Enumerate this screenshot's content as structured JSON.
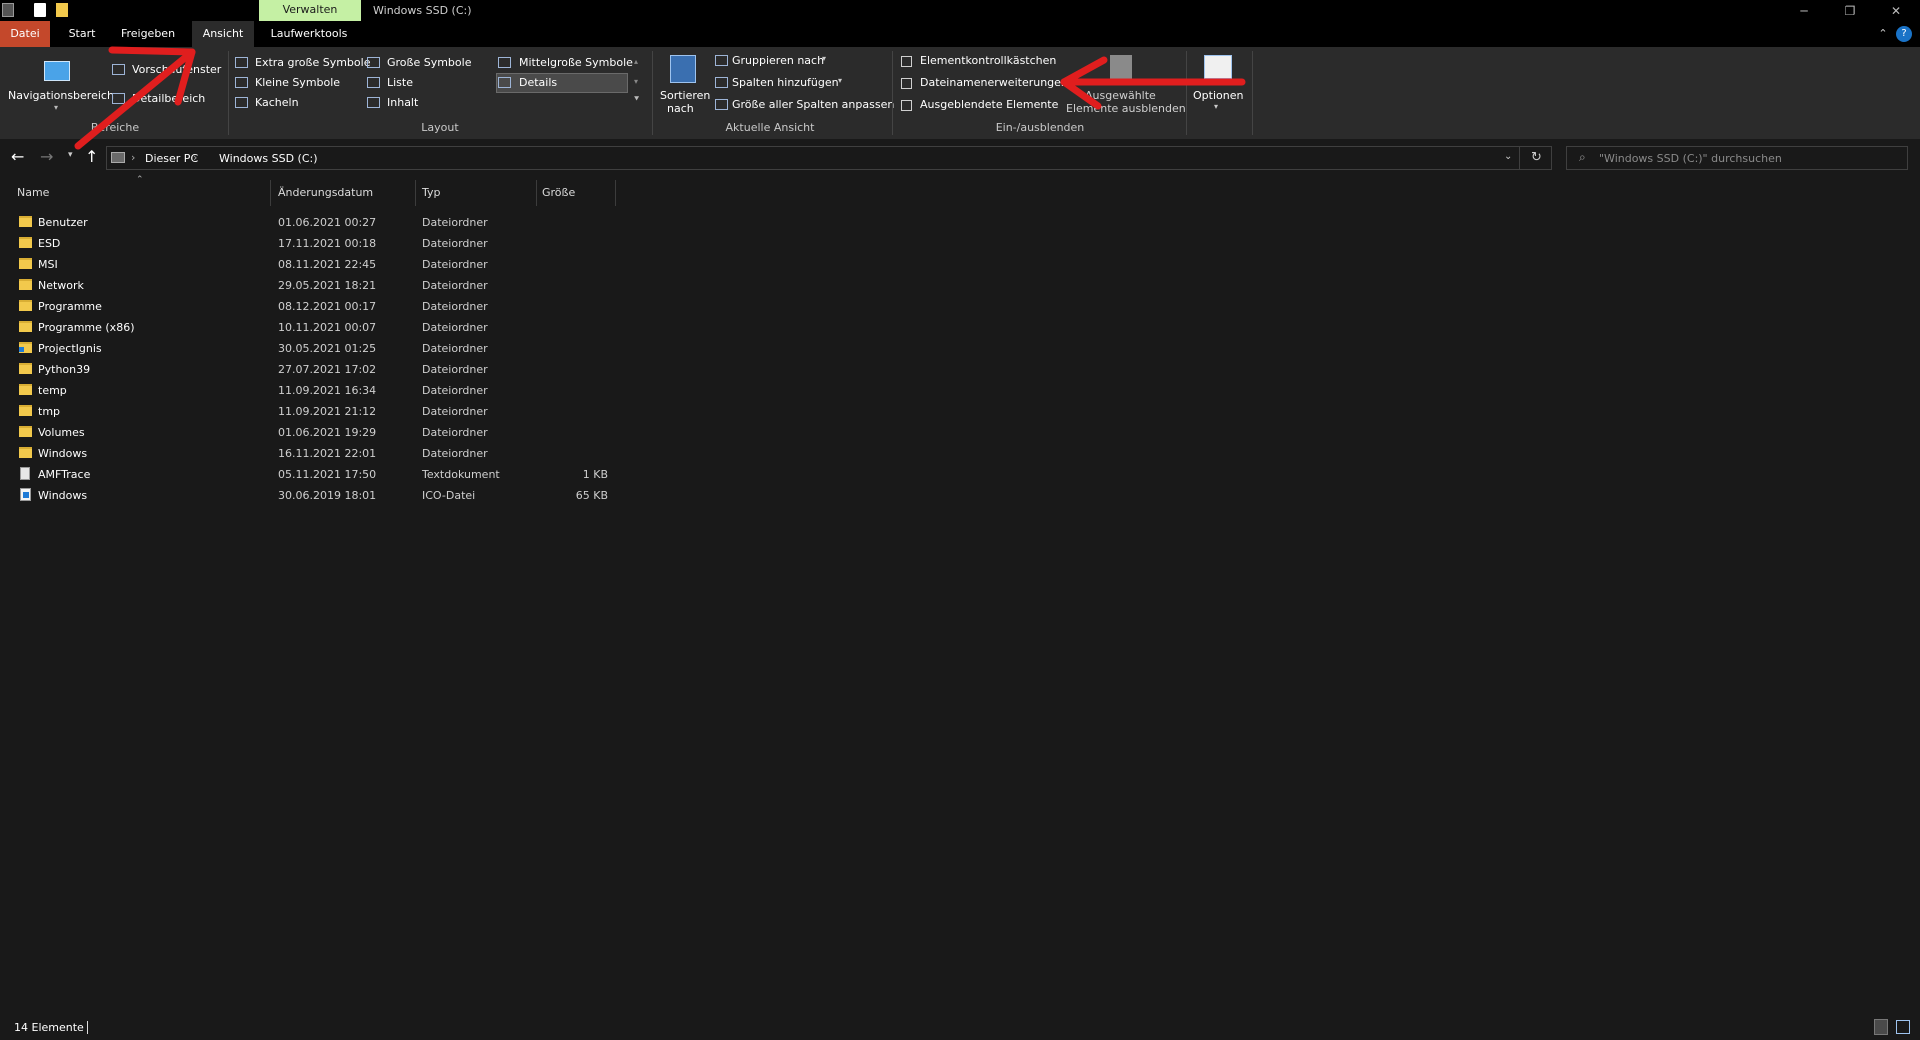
{
  "titlebar": {
    "contextual_tab": "Verwalten",
    "window_title": "Windows SSD (C:)",
    "controls": [
      "minimize-icon",
      "restore-icon",
      "close-icon"
    ]
  },
  "ribbon_tabs": [
    "Datei",
    "Start",
    "Freigeben",
    "Ansicht",
    "Laufwerktools"
  ],
  "ribbon": {
    "bereiche": {
      "nav_label": "Navigationsbereich",
      "vorschau": "Vorschaufenster",
      "details": "Detailbereich",
      "group_label": "Bereiche"
    },
    "layout": {
      "options": [
        "Extra große Symbole",
        "Große Symbole",
        "Mittelgroße Symbole",
        "Kleine Symbole",
        "Liste",
        "Details",
        "Kacheln",
        "Inhalt"
      ],
      "selected": "Details",
      "group_label": "Layout"
    },
    "aktuelle_ansicht": {
      "sortieren": "Sortieren",
      "sortieren_2": "nach",
      "gruppieren": "Gruppieren nach",
      "spalten": "Spalten hinzufügen",
      "groesse": "Größe aller Spalten anpassen",
      "group_label": "Aktuelle Ansicht"
    },
    "ein_ausblenden": {
      "checkboxes": [
        "Elementkontrollkästchen",
        "Dateinamenerweiterungen",
        "Ausgeblendete Elemente"
      ],
      "ausgewaehlte_1": "Ausgewählte",
      "ausgewaehlte_2": "Elemente ausblenden",
      "group_label": "Ein-/ausblenden"
    },
    "optionen": "Optionen"
  },
  "address": {
    "breadcrumb": [
      "Dieser PC",
      "Windows SSD (C:)"
    ],
    "search_placeholder": "\"Windows SSD (C:)\" durchsuchen"
  },
  "columns": [
    "Name",
    "Änderungsdatum",
    "Typ",
    "Größe"
  ],
  "files": [
    {
      "name": "Benutzer",
      "date": "01.06.2021 00:27",
      "type": "Dateiordner",
      "size": "",
      "icon": "folder-icon"
    },
    {
      "name": "ESD",
      "date": "17.11.2021 00:18",
      "type": "Dateiordner",
      "size": "",
      "icon": "folder-icon"
    },
    {
      "name": "MSI",
      "date": "08.11.2021 22:45",
      "type": "Dateiordner",
      "size": "",
      "icon": "folder-icon"
    },
    {
      "name": "Network",
      "date": "29.05.2021 18:21",
      "type": "Dateiordner",
      "size": "",
      "icon": "folder-icon"
    },
    {
      "name": "Programme",
      "date": "08.12.2021 00:17",
      "type": "Dateiordner",
      "size": "",
      "icon": "folder-icon"
    },
    {
      "name": "Programme (x86)",
      "date": "10.11.2021 00:07",
      "type": "Dateiordner",
      "size": "",
      "icon": "folder-icon"
    },
    {
      "name": "ProjectIgnis",
      "date": "30.05.2021 01:25",
      "type": "Dateiordner",
      "size": "",
      "icon": "folder-shortcut-icon"
    },
    {
      "name": "Python39",
      "date": "27.07.2021 17:02",
      "type": "Dateiordner",
      "size": "",
      "icon": "folder-icon"
    },
    {
      "name": "temp",
      "date": "11.09.2021 16:34",
      "type": "Dateiordner",
      "size": "",
      "icon": "folder-icon"
    },
    {
      "name": "tmp",
      "date": "11.09.2021 21:12",
      "type": "Dateiordner",
      "size": "",
      "icon": "folder-icon"
    },
    {
      "name": "Volumes",
      "date": "01.06.2021 19:29",
      "type": "Dateiordner",
      "size": "",
      "icon": "folder-icon"
    },
    {
      "name": "Windows",
      "date": "16.11.2021 22:01",
      "type": "Dateiordner",
      "size": "",
      "icon": "folder-icon"
    },
    {
      "name": "AMFTrace",
      "date": "05.11.2021 17:50",
      "type": "Textdokument",
      "size": "1 KB",
      "icon": "text-document-icon"
    },
    {
      "name": "Windows",
      "date": "30.06.2019 18:01",
      "type": "ICO-Datei",
      "size": "65 KB",
      "icon": "ico-file-icon"
    }
  ],
  "status": {
    "count": "14 Elemente"
  },
  "colors": {
    "accent_datei": "#c4482b",
    "verwalten_tab": "#c5f0a4",
    "annotation": "#e01e1e"
  }
}
